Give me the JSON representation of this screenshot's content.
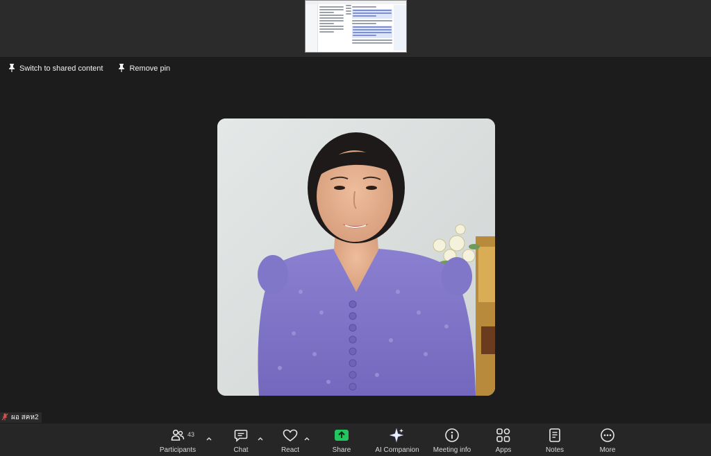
{
  "pin_row": {
    "switch_label": "Switch to shared content",
    "remove_pin_label": "Remove pin"
  },
  "participant": {
    "name": "ผอ สคห2"
  },
  "toolbar": {
    "participants_label": "Participants",
    "participants_count": "43",
    "chat_label": "Chat",
    "react_label": "React",
    "share_label": "Share",
    "ai_label": "AI Companion",
    "meeting_info_label": "Meeting info",
    "apps_label": "Apps",
    "notes_label": "Notes",
    "more_label": "More"
  },
  "colors": {
    "share_accent": "#22c55e",
    "background": "#1c1c1c",
    "toolbar_bg": "#262626",
    "mic_muted": "#e05252"
  },
  "icons": [
    "pin-icon",
    "muted-mic-icon",
    "participants-icon",
    "chat-icon",
    "heart-icon",
    "share-arrow-icon",
    "sparkle-icon",
    "info-icon",
    "apps-icon",
    "notes-icon",
    "more-dots-icon",
    "chevron-up-icon"
  ]
}
